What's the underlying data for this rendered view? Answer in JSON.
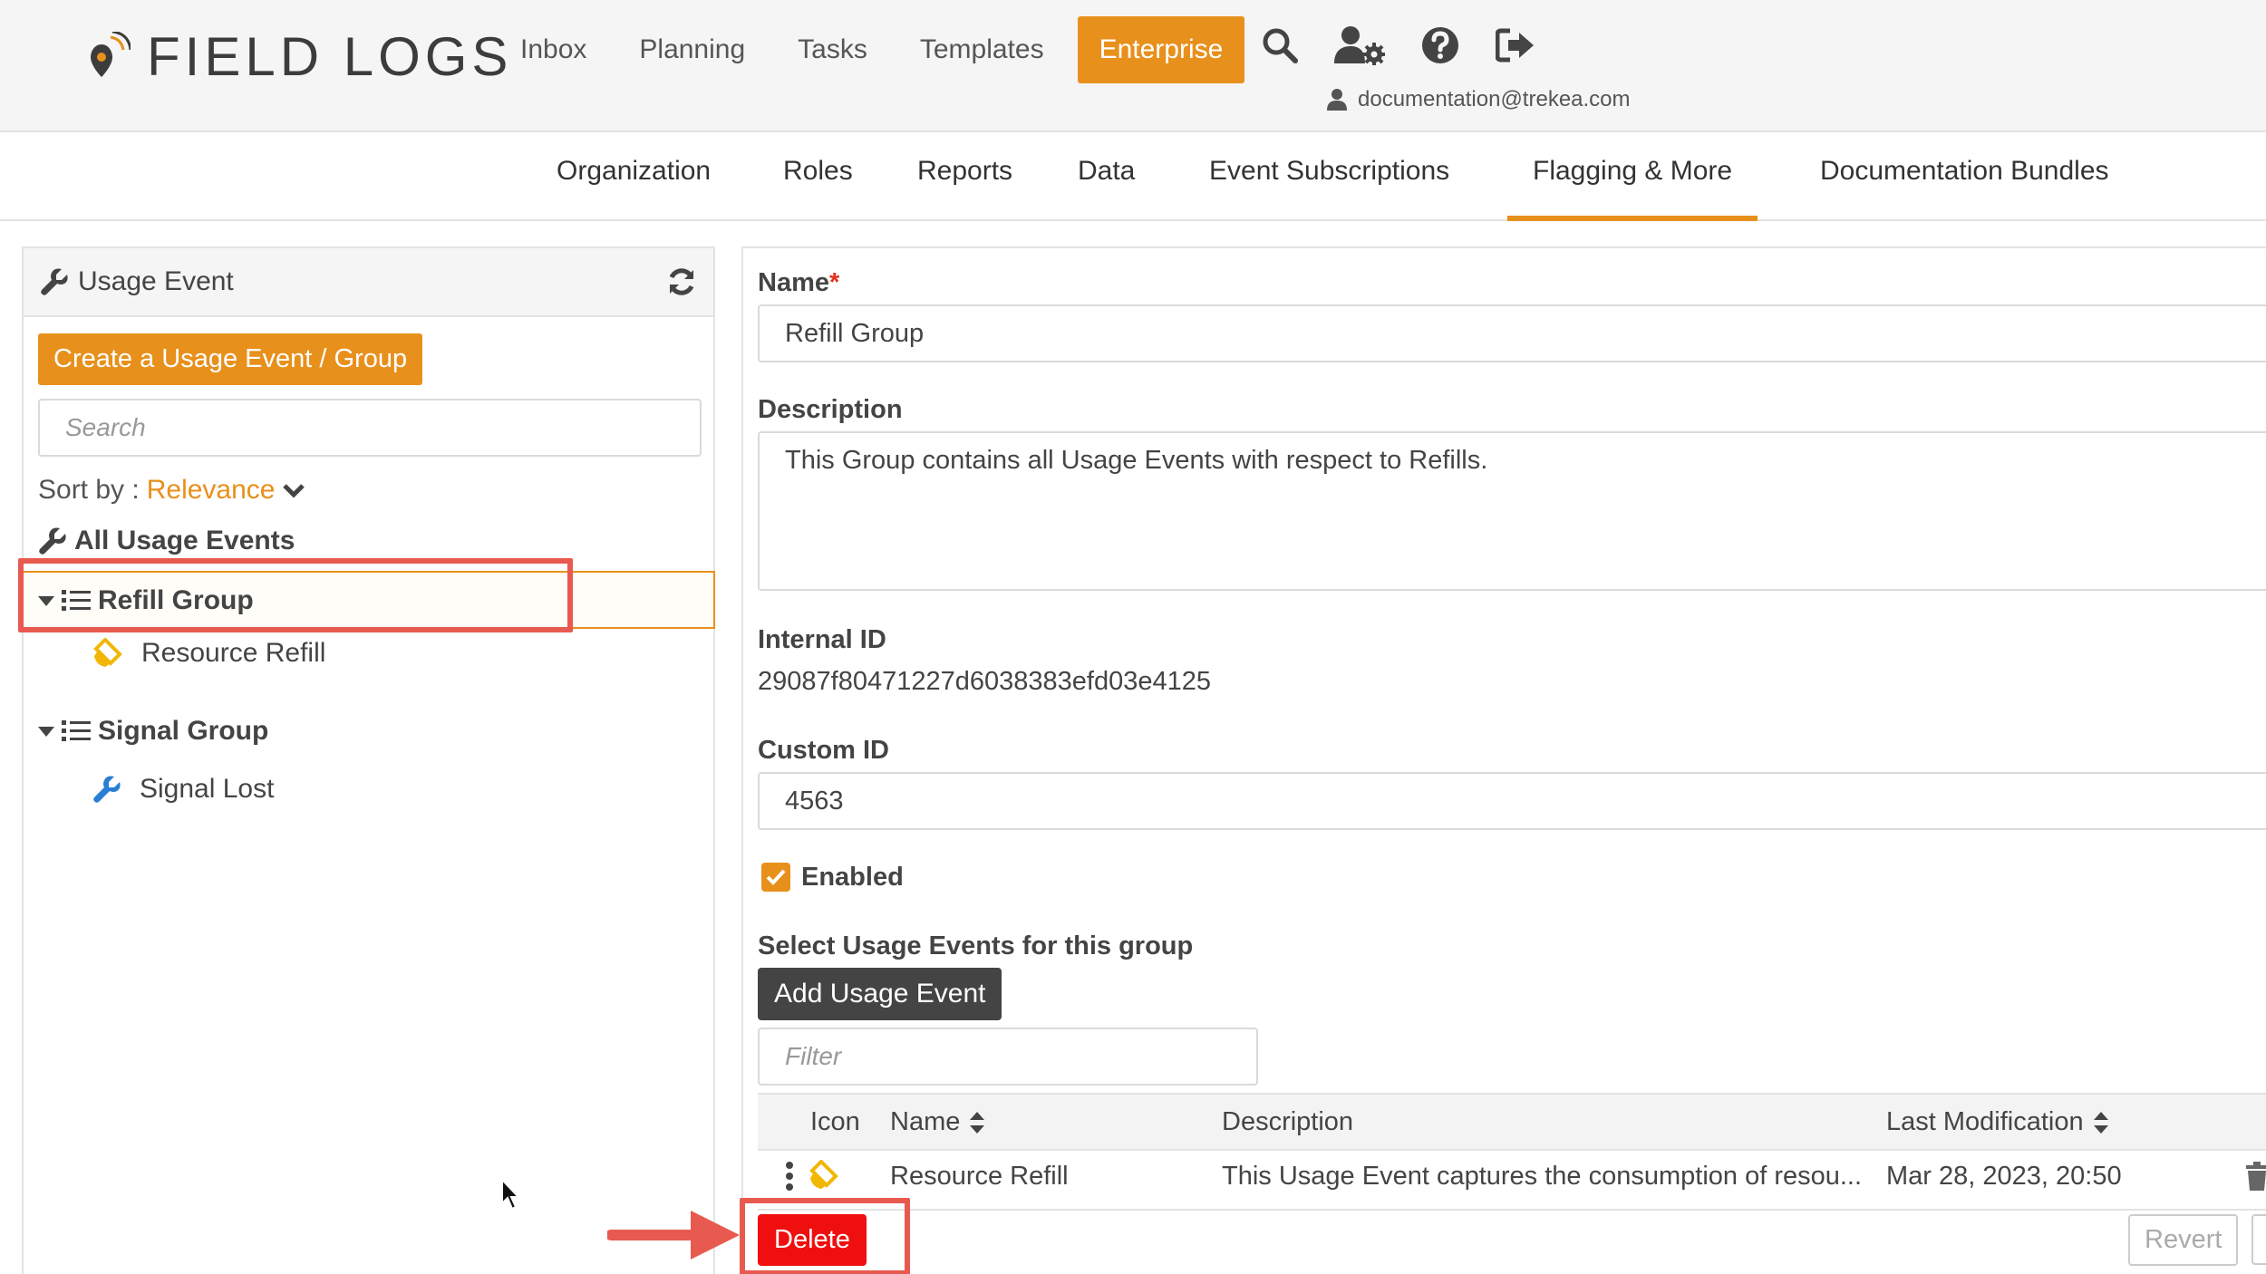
{
  "app": {
    "logo": "FIELD LOGS"
  },
  "nav": {
    "items": [
      "Inbox",
      "Planning",
      "Tasks",
      "Templates",
      "Enterprise"
    ],
    "active": "Enterprise"
  },
  "user": {
    "email": "documentation@trekea.com"
  },
  "subtabs": {
    "items": [
      "Organization",
      "Roles",
      "Reports",
      "Data",
      "Event Subscriptions",
      "Flagging & More",
      "Documentation Bundles"
    ],
    "active": "Flagging & More"
  },
  "left": {
    "title": "Usage Event",
    "create_label": "Create a Usage Event / Group",
    "search_placeholder": "Search",
    "sort_label": "Sort by :",
    "sort_value": "Relevance",
    "all_label": "All Usage Events",
    "groups": [
      {
        "label": "Refill Group",
        "children": [
          "Resource Refill"
        ]
      },
      {
        "label": "Signal Group",
        "children": [
          "Signal Lost"
        ]
      }
    ]
  },
  "form": {
    "name_label": "Name",
    "required_mark": "*",
    "name_value": "Refill Group",
    "description_label": "Description",
    "description_value": "This Group contains all Usage Events with respect to Refills.",
    "internal_id_label": "Internal ID",
    "internal_id_value": "29087f80471227d6038383efd03e4125",
    "custom_id_label": "Custom ID",
    "custom_id_value": "4563",
    "enabled_label": "Enabled",
    "enabled": true,
    "select_label": "Select Usage Events for this group",
    "add_label": "Add Usage Event",
    "filter_placeholder": "Filter"
  },
  "table": {
    "columns": [
      "Icon",
      "Name",
      "Description",
      "Last Modification"
    ],
    "rows": [
      {
        "name": "Resource Refill",
        "description": "This Usage Event captures the consumption of resou...",
        "modified": "Mar 28, 2023, 20:50"
      }
    ]
  },
  "actions": {
    "delete_label": "Delete",
    "revert_label": "Revert"
  },
  "colors": {
    "accent": "#e8901c",
    "danger": "#f00f0f",
    "highlight": "#e85a4f"
  }
}
